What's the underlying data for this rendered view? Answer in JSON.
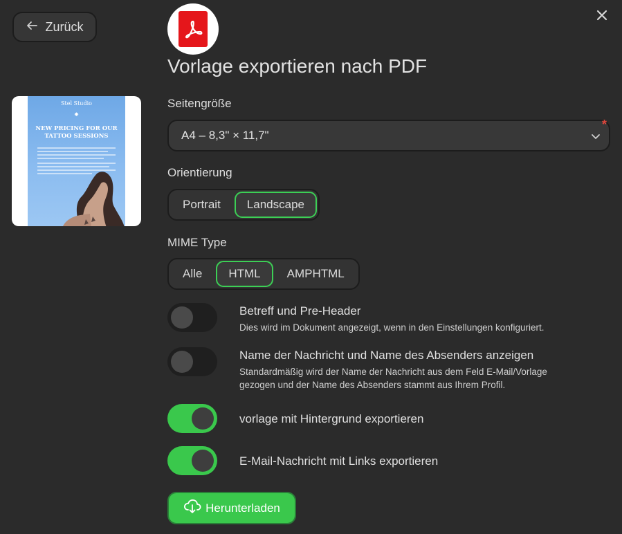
{
  "header": {
    "back_label": "Zurück",
    "title": "Vorlage exportieren nach PDF"
  },
  "preview": {
    "brand": "Stel Studio",
    "headline": "NEW PRICING FOR OUR TATTOO SESSIONS"
  },
  "page_size": {
    "label": "Seitengröße",
    "value": "A4 – 8,3\" × 11,7\"",
    "required_mark": "*"
  },
  "orientation": {
    "label": "Orientierung",
    "options": [
      "Portrait",
      "Landscape"
    ],
    "selected": "Landscape"
  },
  "mime": {
    "label": "MIME Type",
    "options": [
      "Alle",
      "HTML",
      "AMPHTML"
    ],
    "selected": "HTML"
  },
  "options": [
    {
      "title": "Betreff und Pre-Header",
      "desc": "Dies wird im Dokument angezeigt, wenn in den Einstellungen konfiguriert.",
      "enabled": false
    },
    {
      "title": "Name der Nachricht und Name des Absenders anzeigen",
      "desc_line1": "Standardmäßig wird der Name der Nachricht aus dem Feld E-Mail/Vorlage",
      "desc_line2": "gezogen und der Name des Absenders stammt aus Ihrem Profil.",
      "enabled": false
    },
    {
      "title": "vorlage mit Hintergrund exportieren",
      "enabled": true
    },
    {
      "title": "E-Mail-Nachricht mit Links exportieren",
      "enabled": true
    }
  ],
  "download_label": "Herunterladen",
  "colors": {
    "background": "#2b2b2b",
    "accent_green": "#3ac84c",
    "pdf_red": "#e5161b",
    "required_red": "#e0473d"
  },
  "icons": [
    "arrow-left-icon",
    "close-icon",
    "adobe-pdf-icon",
    "chevron-down-icon",
    "cloud-download-icon"
  ]
}
